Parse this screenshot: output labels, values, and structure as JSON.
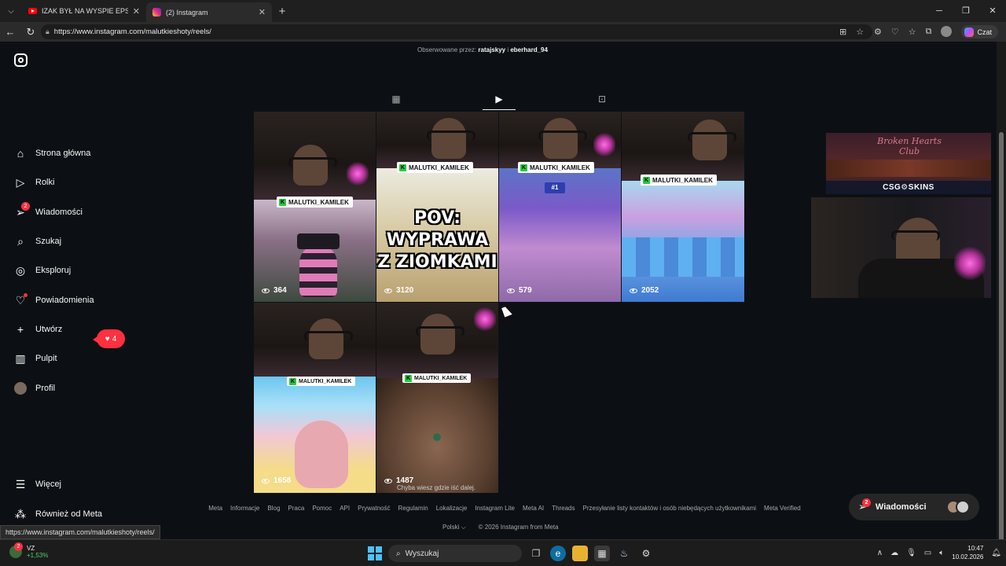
{
  "browser": {
    "tabs": [
      {
        "title": "IZAK BYŁ NA WYSPIE EPSTEINA?! 🇵🇱",
        "close": "✕"
      },
      {
        "title": "(2) Instagram",
        "close": "✕"
      }
    ],
    "new_tab": "+",
    "url": "https://www.instagram.com/malutkieshoty/reels/",
    "copilot_label": "Czat",
    "status_url": "https://www.instagram.com/malutkieshoty/reels/"
  },
  "sidebar": {
    "items": [
      {
        "label": "Strona główna",
        "icon": "home-icon"
      },
      {
        "label": "Rolki",
        "icon": "reels-icon"
      },
      {
        "label": "Wiadomości",
        "icon": "messenger-icon",
        "badge": "2"
      },
      {
        "label": "Szukaj",
        "icon": "search-icon"
      },
      {
        "label": "Eksploruj",
        "icon": "compass-icon"
      },
      {
        "label": "Powiadomienia",
        "icon": "heart-icon"
      },
      {
        "label": "Utwórz",
        "icon": "plus-icon"
      },
      {
        "label": "Pulpit",
        "icon": "dashboard-icon"
      },
      {
        "label": "Profil",
        "icon": "avatar"
      }
    ],
    "notifications_count": "4",
    "more": "Więcej",
    "also_from_meta": "Również od Meta"
  },
  "profile": {
    "followed_by_prefix": "Obserwowane przez:",
    "followed_by_1": "ratajskyy",
    "followed_by_sep": "i",
    "followed_by_2": "eberhard_94"
  },
  "reels": [
    {
      "tag": "MALUTKI_KAMILEK",
      "views": "364"
    },
    {
      "tag": "MALUTKI_KAMILEK",
      "views": "3120",
      "overlay_lines": [
        "POV:",
        "WYPRAWA",
        "Z ZIOMKAMI"
      ]
    },
    {
      "tag": "MALUTKI_KAMILEK",
      "views": "579",
      "game_badge": "#1"
    },
    {
      "tag": "MALUTKI_KAMILEK",
      "views": "2052"
    },
    {
      "tag": "MALUTKI_KAMILEK",
      "views": "1658"
    },
    {
      "tag": "MALUTKI_KAMILEK",
      "views": "1487",
      "subtitle": "Chyba wiesz gdzie iść dalej."
    }
  ],
  "overlay": {
    "banner_title": "Broken Hearts Club",
    "banner_sponsor": "CSG⚙SKINS"
  },
  "footer": {
    "links": [
      "Meta",
      "Informacje",
      "Blog",
      "Praca",
      "Pomoc",
      "API",
      "Prywatność",
      "Regulamin",
      "Lokalizacje",
      "Instagram Lite",
      "Meta AI",
      "Threads",
      "Przesyłanie listy kontaktów i osób niebędących użytkownikami",
      "Meta Verified"
    ],
    "language": "Polski ⌵",
    "copyright": "© 2026 Instagram from Meta"
  },
  "messages_pill": {
    "label": "Wiadomości",
    "badge": "2"
  },
  "taskbar": {
    "stock_name": "VZ",
    "stock_change": "+1,53%",
    "stock_badge": "2",
    "search_placeholder": "Wyszukaj",
    "time": "10:47",
    "date": "10.02.2026"
  }
}
